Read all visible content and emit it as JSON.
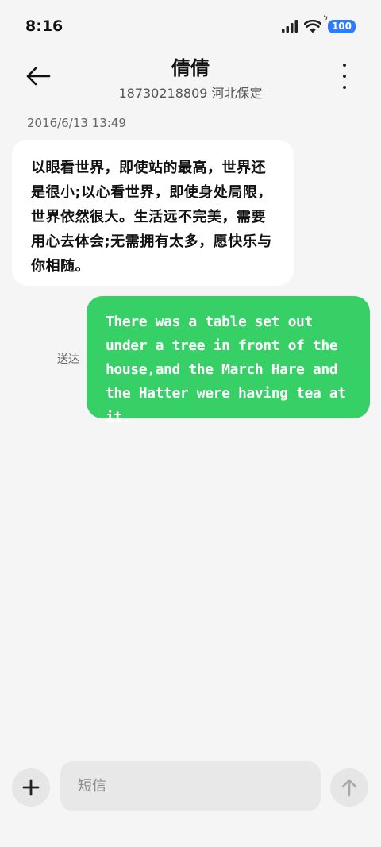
{
  "status_bar": {
    "time": "8:16",
    "battery_level": "100",
    "icons": [
      "signal-icon",
      "wifi-icon",
      "battery-icon"
    ]
  },
  "header": {
    "contact_name": "倩倩",
    "subtitle": "18730218809 河北保定",
    "icons": [
      "back-arrow-icon",
      "more-vertical-icon"
    ]
  },
  "conversation": {
    "date": "2016/6/13 13:49",
    "incoming_message": "以眼看世界，即使站的最高，世界还是很小;以心看世界，即使身处局限，世界依然很大。生活远不完美，需要用心去体会;无需拥有太多，愿快乐与你相随。",
    "outgoing_message": "There was a table set out under a tree in front of the house,and the March Hare and the Hatter were having tea at it.",
    "outgoing_status": "送达"
  },
  "composer": {
    "placeholder": "短信",
    "icons": [
      "plus-icon",
      "send-arrow-up-icon"
    ]
  },
  "colors": {
    "background": "#f5f5f5",
    "incoming_bubble": "#ffffff",
    "outgoing_bubble": "#36d067",
    "battery_badge": "#2b7cff"
  }
}
